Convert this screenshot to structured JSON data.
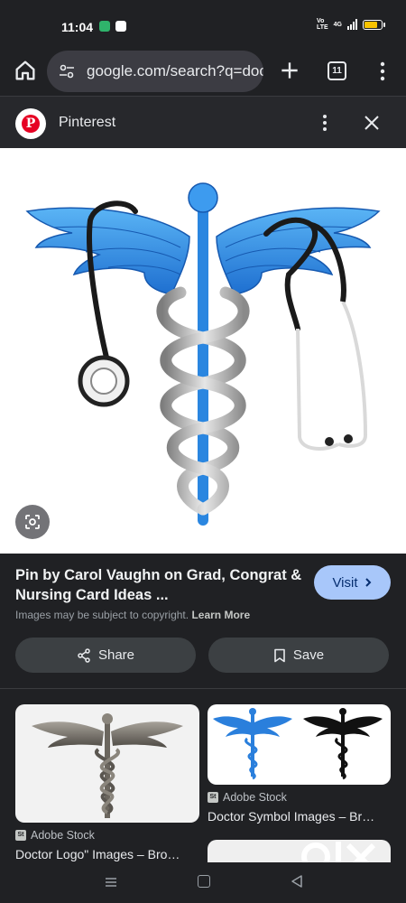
{
  "status_bar": {
    "time": "11:04",
    "volte_label": "Vo\nLTE",
    "network_label": "4G",
    "battery_color": "#f9c300",
    "battery_level": 0.75
  },
  "browser": {
    "url": "google.com/search?q=doc",
    "tab_count": "11",
    "icons": [
      "home-icon",
      "tune-icon",
      "plus-icon",
      "tab-switcher-icon",
      "more-vert-icon"
    ]
  },
  "source": {
    "name": "Pinterest",
    "brand_color": "#e60023",
    "logo_letter": "P"
  },
  "result": {
    "title": "Pin by Carol Vaughn on Grad, Congrat & Nursing Card Ideas ...",
    "visit_label": "Visit",
    "copyright_text": "Images may be subject to copyright.",
    "learn_more": "Learn More",
    "share_label": "Share",
    "save_label": "Save",
    "accent_color": "#a8c7fa"
  },
  "related": [
    {
      "source": "Adobe Stock",
      "title": "Doctor Logo\" Images – Bro…"
    },
    {
      "source": "Adobe Stock",
      "title": "Doctor Symbol Images – Br…"
    }
  ],
  "adobe_logo_text": "St",
  "watermark": "OLX"
}
